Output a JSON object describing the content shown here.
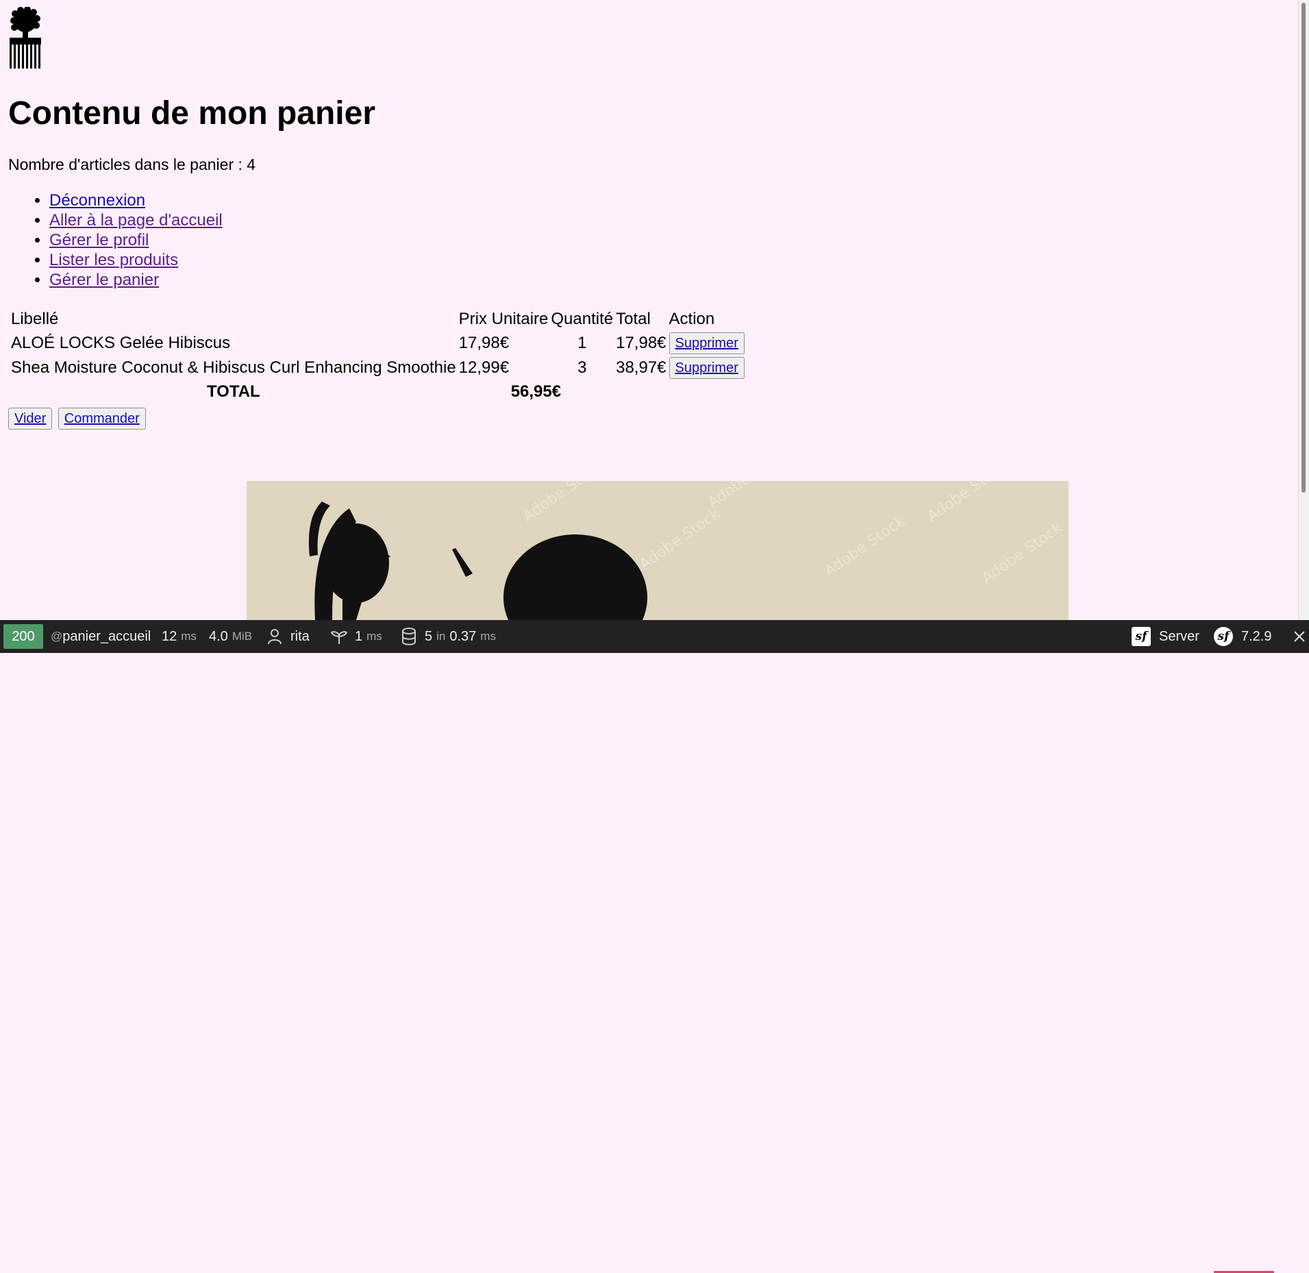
{
  "header": {
    "logo_icon": "afro-comb-icon",
    "title": "Contenu de mon panier",
    "count_label": "Nombre d'articles dans le panier : 4"
  },
  "nav": {
    "items": [
      {
        "label": "Déconnexion"
      },
      {
        "label": "Aller à la page d'accueil"
      },
      {
        "label": "Gérer le profil"
      },
      {
        "label": "Lister les produits"
      },
      {
        "label": "Gérer le panier"
      }
    ]
  },
  "cart": {
    "headers": [
      "Libellé",
      "Prix Unitaire",
      "Quantité",
      "Total",
      "Action"
    ],
    "rows": [
      {
        "name": "ALOÉ LOCKS Gelée Hibiscus",
        "unit_price": "17,98€",
        "quantity": "1",
        "total": "17,98€",
        "action": "Supprimer"
      },
      {
        "name": "Shea Moisture Coconut & Hibiscus Curl Enhancing Smoothie",
        "unit_price": "12,99€",
        "quantity": "3",
        "total": "38,97€",
        "action": "Supprimer"
      }
    ],
    "total_label": "TOTAL",
    "total_value": "56,95€"
  },
  "actions": {
    "empty_label": "Vider",
    "order_label": "Commander"
  },
  "debug_toolbar": {
    "status_code": "200",
    "route": "panier_accueil",
    "route_prefix": "@",
    "time_value": "12",
    "time_unit": "ms",
    "memory_value": "4.0",
    "memory_unit": "MiB",
    "user": "rita",
    "twig_value": "1",
    "twig_unit": "ms",
    "db_queries": "5",
    "db_in": "in",
    "db_time": "0.37",
    "db_unit": "ms",
    "server_label": "Server",
    "symfony_version": "7.2.9",
    "status_color": "#4f9a6a"
  }
}
